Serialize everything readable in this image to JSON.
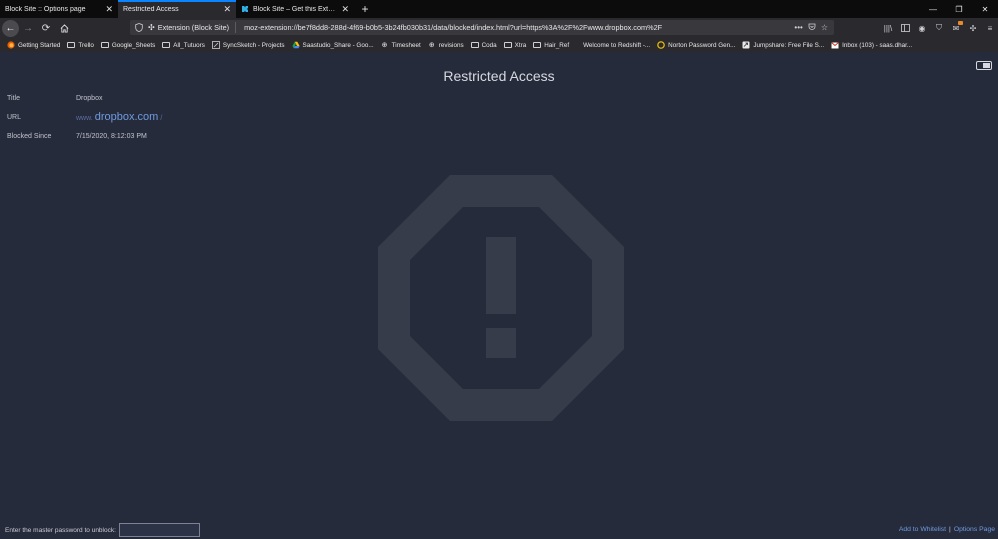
{
  "browser": {
    "tabs": [
      {
        "title": "Block Site :: Options page",
        "active": false
      },
      {
        "title": "Restricted Access",
        "active": true
      },
      {
        "title": "Block Site – Get this Extension for",
        "active": false
      }
    ],
    "new_tab": "+",
    "url_bar": {
      "extension_label": "Extension (Block Site)",
      "url": "moz-extension://be7f8dd8-288d-4f69-b0b5-3b24fb030b31/data/blocked/index.html?url=https%3A%2F%2Fwww.dropbox.com%2F"
    },
    "bookmarks": [
      {
        "label": "Getting Started",
        "icon": "firefox-icon"
      },
      {
        "label": "Trello",
        "icon": "folder-icon"
      },
      {
        "label": "Google_Sheets",
        "icon": "folder-icon"
      },
      {
        "label": "All_Tutuors",
        "icon": "folder-icon"
      },
      {
        "label": "SyncSketch - Projects",
        "icon": "syncsketch-icon"
      },
      {
        "label": "Saastudio_Share - Goo...",
        "icon": "drive-icon"
      },
      {
        "label": "Timesheet",
        "icon": "globe-icon"
      },
      {
        "label": "revisions",
        "icon": "globe-icon"
      },
      {
        "label": "Coda",
        "icon": "folder-icon"
      },
      {
        "label": "Xtra",
        "icon": "folder-icon"
      },
      {
        "label": "Hair_Ref",
        "icon": "folder-icon"
      },
      {
        "label": "Welcome to Redshift -...",
        "icon": "redshift-icon"
      },
      {
        "label": "Norton Password Gen...",
        "icon": "norton-icon"
      },
      {
        "label": "Jumpshare: Free File S...",
        "icon": "jumpshare-icon"
      },
      {
        "label": "Inbox (103) - saas.dhar...",
        "icon": "gmail-icon"
      }
    ]
  },
  "page": {
    "title": "Restricted Access",
    "fields": {
      "title_label": "Title",
      "title_value": "Dropbox",
      "url_label": "URL",
      "url_prefix": "www.",
      "url_domain": "dropbox.com",
      "url_suffix": "/",
      "since_label": "Blocked Since",
      "since_value": "7/15/2020, 8:12:03 PM"
    },
    "footer": {
      "password_prompt": "Enter the master password to unblock:",
      "password_value": "",
      "whitelist_link": "Add to Whitelist",
      "separator": "|",
      "options_link": "Options Page"
    },
    "colors": {
      "background": "#262b3b",
      "stop_sign": "#373c4b",
      "link": "#6f9be0"
    }
  }
}
